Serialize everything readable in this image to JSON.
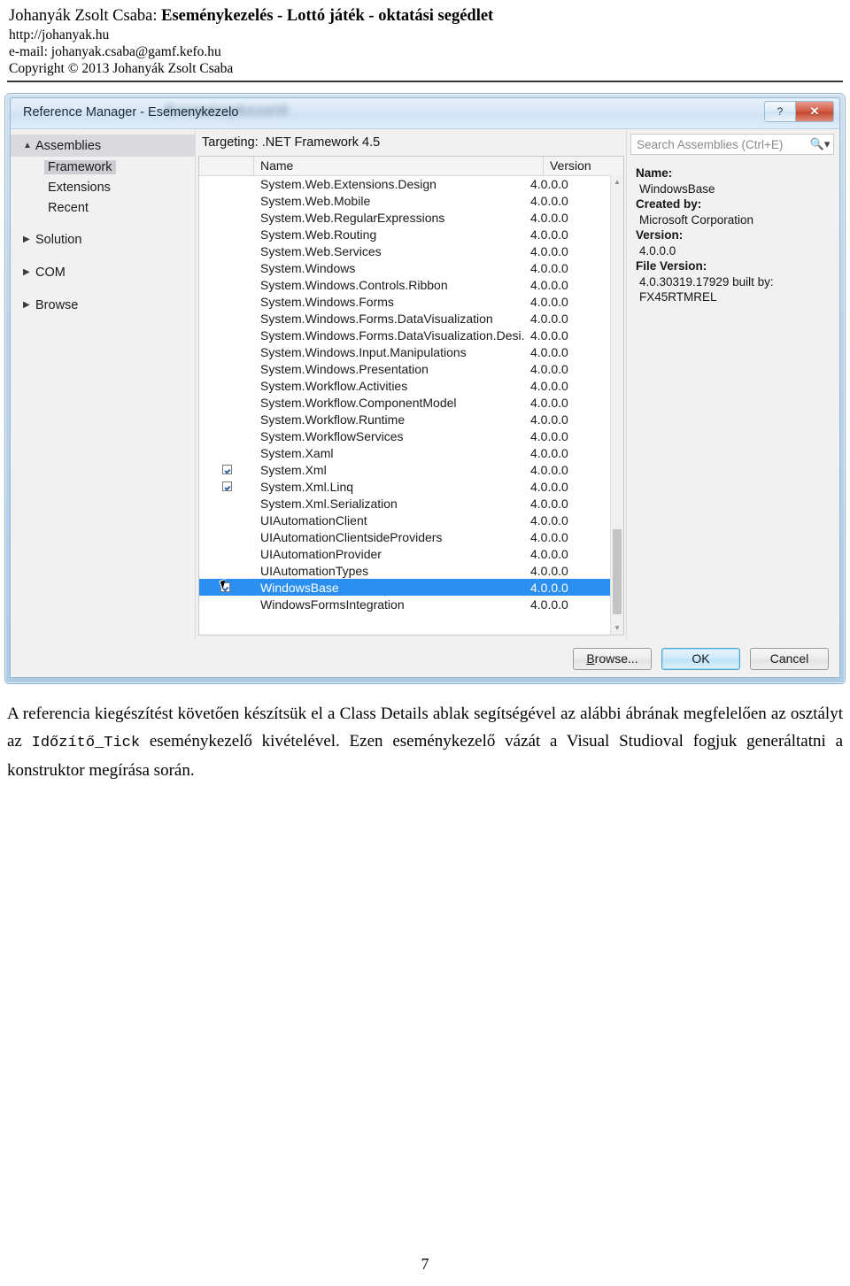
{
  "document_header": {
    "title_author": "Johanyák Zsolt Csaba:",
    "title_main": "Eseménykezelés - Lottó játék - oktatási segédlet",
    "url": "http://johanyak.hu",
    "email": "e-mail: johanyak.csaba@gamf.kefo.hu",
    "copyright": "Copyright © 2013 Johanyák Zsolt Csaba"
  },
  "dialog": {
    "title": "Reference Manager - Esemenykezelo",
    "ghost_text": "Eseménykezelő",
    "help_button": "?",
    "close_button": "✕",
    "nav": {
      "assemblies": {
        "label": "Assemblies",
        "arrow": "▲"
      },
      "children": [
        {
          "label": "Framework"
        },
        {
          "label": "Extensions"
        },
        {
          "label": "Recent"
        }
      ],
      "groups": [
        {
          "label": "Solution",
          "arrow": "▶"
        },
        {
          "label": "COM",
          "arrow": "▶"
        },
        {
          "label": "Browse",
          "arrow": "▶"
        }
      ]
    },
    "targeting": "Targeting: .NET Framework 4.5",
    "grid": {
      "columns": {
        "name": "Name",
        "version": "Version"
      },
      "rows": [
        {
          "name": "System.Web.Extensions.Design",
          "version": "4.0.0.0",
          "checked": false,
          "selected": false
        },
        {
          "name": "System.Web.Mobile",
          "version": "4.0.0.0",
          "checked": false,
          "selected": false
        },
        {
          "name": "System.Web.RegularExpressions",
          "version": "4.0.0.0",
          "checked": false,
          "selected": false
        },
        {
          "name": "System.Web.Routing",
          "version": "4.0.0.0",
          "checked": false,
          "selected": false
        },
        {
          "name": "System.Web.Services",
          "version": "4.0.0.0",
          "checked": false,
          "selected": false
        },
        {
          "name": "System.Windows",
          "version": "4.0.0.0",
          "checked": false,
          "selected": false
        },
        {
          "name": "System.Windows.Controls.Ribbon",
          "version": "4.0.0.0",
          "checked": false,
          "selected": false
        },
        {
          "name": "System.Windows.Forms",
          "version": "4.0.0.0",
          "checked": false,
          "selected": false
        },
        {
          "name": "System.Windows.Forms.DataVisualization",
          "version": "4.0.0.0",
          "checked": false,
          "selected": false
        },
        {
          "name": "System.Windows.Forms.DataVisualization.Desi...",
          "version": "4.0.0.0",
          "checked": false,
          "selected": false
        },
        {
          "name": "System.Windows.Input.Manipulations",
          "version": "4.0.0.0",
          "checked": false,
          "selected": false
        },
        {
          "name": "System.Windows.Presentation",
          "version": "4.0.0.0",
          "checked": false,
          "selected": false
        },
        {
          "name": "System.Workflow.Activities",
          "version": "4.0.0.0",
          "checked": false,
          "selected": false
        },
        {
          "name": "System.Workflow.ComponentModel",
          "version": "4.0.0.0",
          "checked": false,
          "selected": false
        },
        {
          "name": "System.Workflow.Runtime",
          "version": "4.0.0.0",
          "checked": false,
          "selected": false
        },
        {
          "name": "System.WorkflowServices",
          "version": "4.0.0.0",
          "checked": false,
          "selected": false
        },
        {
          "name": "System.Xaml",
          "version": "4.0.0.0",
          "checked": false,
          "selected": false
        },
        {
          "name": "System.Xml",
          "version": "4.0.0.0",
          "checked": true,
          "selected": false
        },
        {
          "name": "System.Xml.Linq",
          "version": "4.0.0.0",
          "checked": true,
          "selected": false
        },
        {
          "name": "System.Xml.Serialization",
          "version": "4.0.0.0",
          "checked": false,
          "selected": false
        },
        {
          "name": "UIAutomationClient",
          "version": "4.0.0.0",
          "checked": false,
          "selected": false
        },
        {
          "name": "UIAutomationClientsideProviders",
          "version": "4.0.0.0",
          "checked": false,
          "selected": false
        },
        {
          "name": "UIAutomationProvider",
          "version": "4.0.0.0",
          "checked": false,
          "selected": false
        },
        {
          "name": "UIAutomationTypes",
          "version": "4.0.0.0",
          "checked": false,
          "selected": false
        },
        {
          "name": "WindowsBase",
          "version": "4.0.0.0",
          "checked": true,
          "selected": true
        },
        {
          "name": "WindowsFormsIntegration",
          "version": "4.0.0.0",
          "checked": false,
          "selected": false
        }
      ]
    },
    "search": {
      "placeholder": "Search Assemblies (Ctrl+E)",
      "icon": "search-icon"
    },
    "details": {
      "name_label": "Name:",
      "name_value": "WindowsBase",
      "created_label": "Created by:",
      "created_value": "Microsoft Corporation",
      "version_label": "Version:",
      "version_value": "4.0.0.0",
      "file_version_label": "File Version:",
      "file_version_value": "4.0.30319.17929 built by:",
      "file_version_value2": "FX45RTMREL"
    },
    "buttons": {
      "browse": "Browse...",
      "browse_accel": "B",
      "browse_rest": "rowse...",
      "ok": "OK",
      "cancel": "Cancel"
    }
  },
  "body": {
    "p1_a": "A referencia kiegészítést követően készítsük el a Class Details ablak segítségével az alábbi ábrának megfelelően az osztályt az ",
    "p1_code": "Időzítő_Tick",
    "p1_b": " eseménykezelő kivételével. Ezen eseménykezelő vázát a Visual Studioval fogjuk generáltatni a konstruktor megírása során."
  },
  "page_number": "7",
  "colors": {
    "selection_blue": "#2a8ff0",
    "close_red": "#c44a32",
    "title_gradient_top": "#e8f1fa",
    "nav_selected": "#d9d9de"
  }
}
